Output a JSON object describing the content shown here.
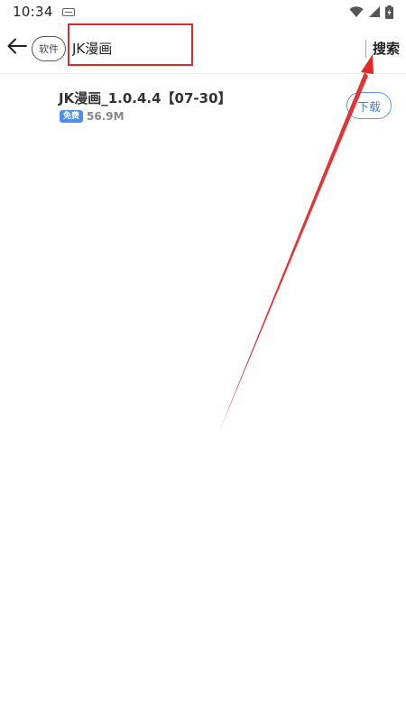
{
  "status_bar": {
    "time": "10:34",
    "icons": [
      "keyboard-icon",
      "wifi-icon",
      "signal-icon",
      "battery-icon"
    ]
  },
  "header": {
    "back_icon": "arrow-left-icon",
    "category_label": "软件",
    "search_value": "JK漫画",
    "search_button_label": "搜索"
  },
  "results": [
    {
      "title": "JK漫画_1.0.4.4【07-30】",
      "badge": "免费",
      "size": "56.9M",
      "download_label": "下载"
    }
  ],
  "colors": {
    "accent_blue": "#3a82e8",
    "badge_blue": "#4d8ff0",
    "annotation_red": "#e02a2a"
  }
}
